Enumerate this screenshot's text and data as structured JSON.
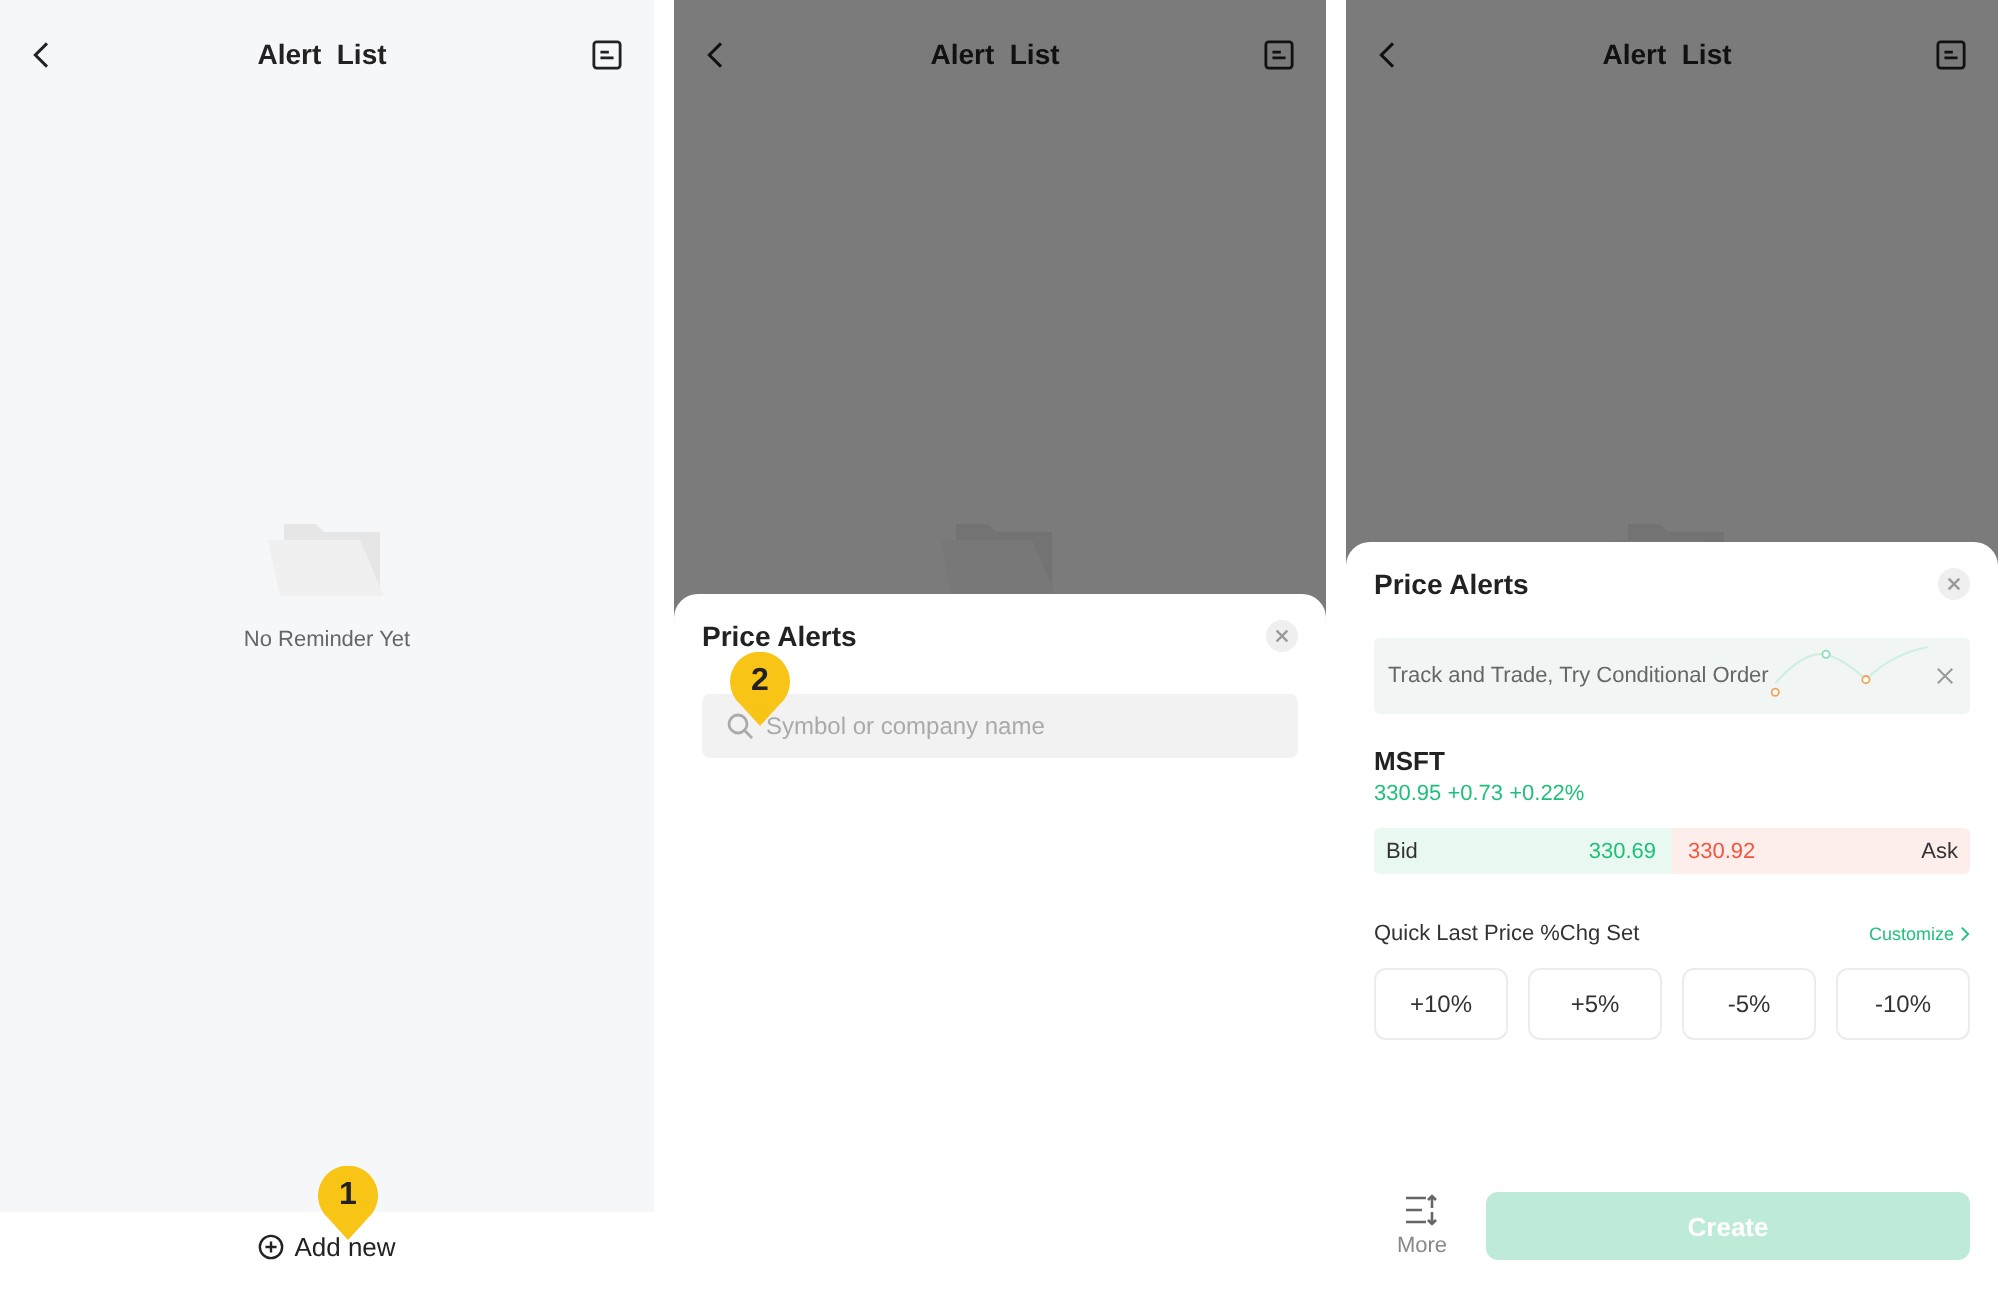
{
  "screens": [
    {
      "header": {
        "title": "Alert  List"
      },
      "dimmed": false,
      "empty_state": {
        "message": "No Reminder Yet"
      },
      "footer": {
        "add_button": "Add new"
      },
      "callout": {
        "number": "1"
      }
    },
    {
      "header": {
        "title": "Alert  List"
      },
      "dimmed": true,
      "sheet": {
        "kind": "search",
        "title": "Price Alerts",
        "search": {
          "placeholder": "Symbol or company name"
        }
      },
      "callout": {
        "number": "2"
      }
    },
    {
      "header": {
        "title": "Alert  List"
      },
      "dimmed": true,
      "sheet": {
        "kind": "alert_form",
        "title": "Price Alerts",
        "banner": {
          "text": "Track and Trade, Try Conditional Order"
        },
        "quote": {
          "symbol": "MSFT",
          "price_line": "330.95 +0.73 +0.22%",
          "bid_label": "Bid",
          "bid": "330.69",
          "ask": "330.92",
          "ask_label": "Ask"
        },
        "quick_set": {
          "label": "Quick Last Price %Chg Set",
          "customize": "Customize",
          "options": [
            "+10%",
            "+5%",
            "-5%",
            "-10%"
          ]
        },
        "more": "More",
        "create_button": {
          "label": "Create",
          "disabled": true
        }
      }
    }
  ]
}
